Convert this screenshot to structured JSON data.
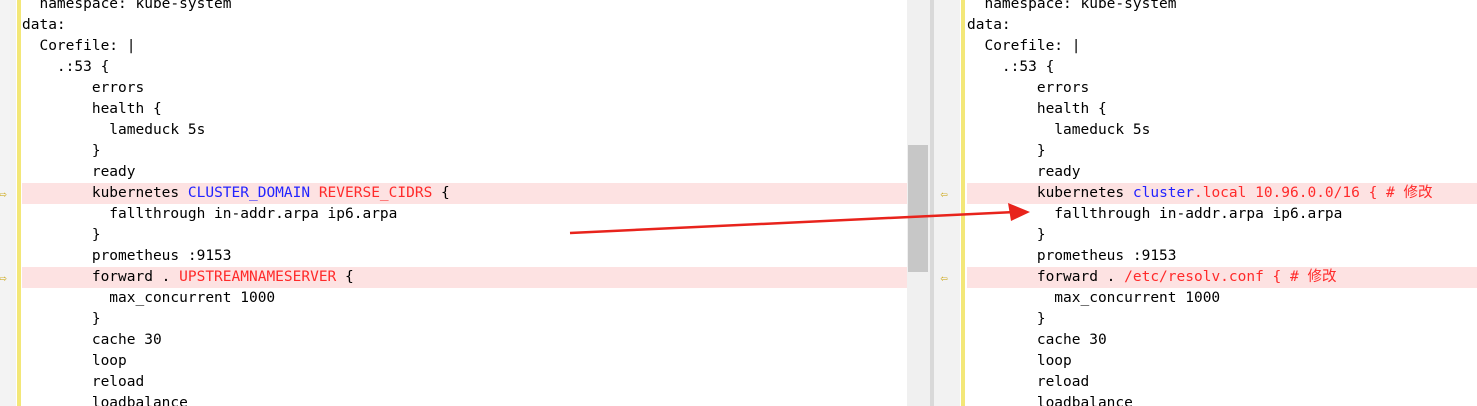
{
  "left": {
    "lines": [
      {
        "text": "  namespace: kube-system"
      },
      {
        "text": "data:"
      },
      {
        "text": "  Corefile: |"
      },
      {
        "text": "    .:53 {"
      },
      {
        "text": "        errors"
      },
      {
        "text": "        health {"
      },
      {
        "text": "          lameduck 5s"
      },
      {
        "text": "        }"
      },
      {
        "text": "        ready"
      },
      {
        "changed": true,
        "parts": [
          {
            "t": "        kubernetes "
          },
          {
            "t": "CLUSTER_DOMAIN",
            "c": "kw"
          },
          {
            "t": " "
          },
          {
            "t": "REVERSE_CIDRS",
            "c": "red"
          },
          {
            "t": " {"
          }
        ]
      },
      {
        "text": "          fallthrough in-addr.arpa ip6.arpa"
      },
      {
        "text": "        }"
      },
      {
        "text": "        prometheus :9153"
      },
      {
        "changed": true,
        "parts": [
          {
            "t": "        forward . "
          },
          {
            "t": "UPSTREAMNAMESERVER",
            "c": "red"
          },
          {
            "t": " {"
          }
        ]
      },
      {
        "text": "          max_concurrent 1000"
      },
      {
        "text": "        }"
      },
      {
        "text": "        cache 30"
      },
      {
        "text": "        loop"
      },
      {
        "text": "        reload"
      },
      {
        "text": "        loadbalance"
      }
    ]
  },
  "right": {
    "lines": [
      {
        "text": "  namespace: kube-system"
      },
      {
        "text": "data:"
      },
      {
        "text": "  Corefile: |"
      },
      {
        "text": "    .:53 {"
      },
      {
        "text": "        errors"
      },
      {
        "text": "        health {"
      },
      {
        "text": "          lameduck 5s"
      },
      {
        "text": "        }"
      },
      {
        "text": "        ready"
      },
      {
        "changed": true,
        "parts": [
          {
            "t": "        kubernetes "
          },
          {
            "t": "cluster",
            "c": "kw"
          },
          {
            "t": ".local 10.96.0.0/16 { # 修改",
            "c": "red"
          }
        ]
      },
      {
        "text": "          fallthrough in-addr.arpa ip6.arpa"
      },
      {
        "text": "        }"
      },
      {
        "text": "        prometheus :9153"
      },
      {
        "changed": true,
        "parts": [
          {
            "t": "        forward . "
          },
          {
            "t": "/etc/resolv.conf { # 修改",
            "c": "red"
          }
        ]
      },
      {
        "text": "          max_concurrent 1000"
      },
      {
        "text": "        }"
      },
      {
        "text": "        cache 30"
      },
      {
        "text": "        loop"
      },
      {
        "text": "        reload"
      },
      {
        "text": "        loadbalance"
      }
    ]
  },
  "markers": {
    "left_icon": "arrow-right-icon",
    "right_icon": "arrow-left-icon",
    "left_glyph": "⇨",
    "right_glyph": "⇦"
  },
  "colors": {
    "changed_line_bg": "#fde2e2",
    "keyword": "#2323ff",
    "changed_token": "#ff2a2a",
    "change_strip": "#f3e778",
    "annotation_arrow": "#e8231c"
  }
}
